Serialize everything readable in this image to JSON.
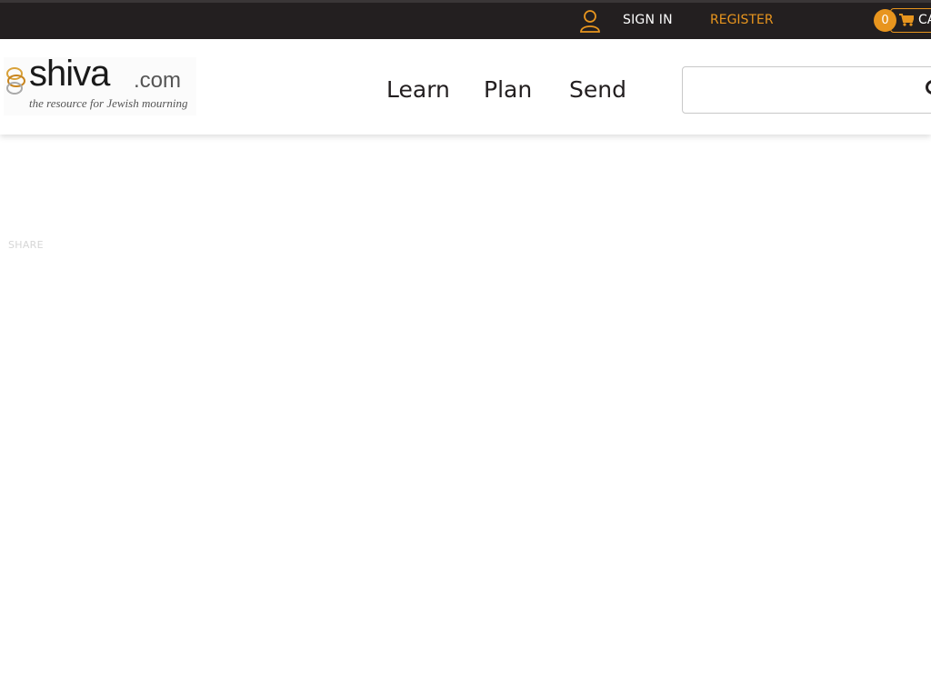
{
  "topbar": {
    "signin_label": "SIGN IN",
    "register_label": "REGISTER",
    "cart_count": "0",
    "cart_label": "CART",
    "user_icon": "user-icon",
    "cart_icon": "shopping-cart-icon"
  },
  "header": {
    "logo": {
      "brand": "shiva",
      "domain": ".com",
      "tagline": "the resource for Jewish mourning"
    },
    "nav": {
      "learn": "Learn",
      "plan": "Plan",
      "send": "Send"
    },
    "search": {
      "value": "",
      "icon": "search-icon"
    }
  },
  "main": {
    "share_label": "SHARE"
  },
  "colors": {
    "topbar_bg": "#231f20",
    "accent": "#e8951e",
    "nav_text": "#231f20"
  }
}
